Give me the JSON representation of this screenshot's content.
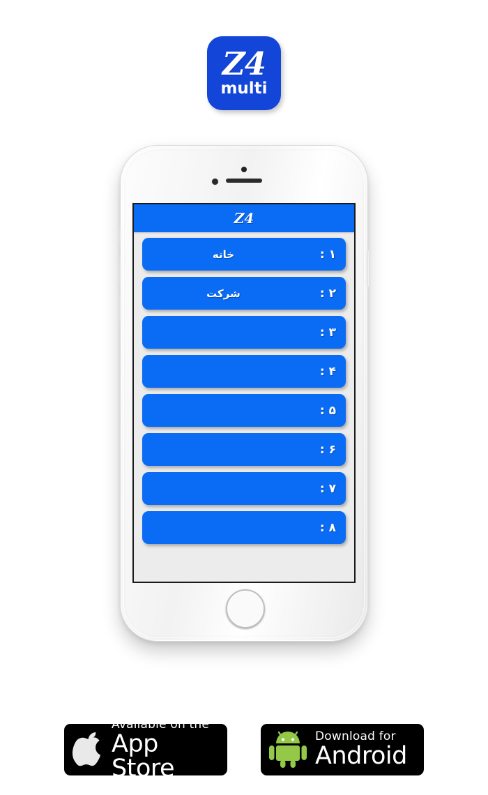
{
  "logo": {
    "name": "z4-multi-app-icon",
    "title": "Z4",
    "subtitle": "multi",
    "background_color": "#1346d8",
    "text_color": "#ffffff"
  },
  "phone": {
    "name": "white-iphone-mockup",
    "body_color": "#f5f5f5",
    "screen_border_color": "#1b1b1b"
  },
  "app": {
    "header": {
      "title": "Z4",
      "background_color": "#0a6cf4",
      "text_color": "#ffffff"
    },
    "screen_background_color": "#ececed",
    "button_color": "#0a6cf4",
    "slots": [
      {
        "index": "۱ :",
        "label": "خانه"
      },
      {
        "index": "۲ :",
        "label": "شرکت"
      },
      {
        "index": "۳ :",
        "label": ""
      },
      {
        "index": "۴ :",
        "label": ""
      },
      {
        "index": "۵ :",
        "label": ""
      },
      {
        "index": "۶ :",
        "label": ""
      },
      {
        "index": "۷ :",
        "label": ""
      },
      {
        "index": "۸ :",
        "label": ""
      }
    ]
  },
  "store_badges": {
    "app_store": {
      "small_text": "Available on the",
      "big_text": "App Store",
      "icon": "apple-logo-icon",
      "background_color": "#000000"
    },
    "google_play": {
      "small_text": "Download for",
      "big_text": "Android",
      "icon": "android-robot-icon",
      "icon_color": "#94c947",
      "background_color": "#000000"
    }
  }
}
